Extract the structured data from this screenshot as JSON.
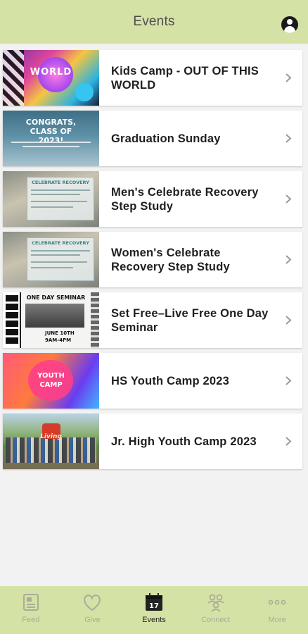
{
  "header": {
    "title": "Events"
  },
  "events": [
    {
      "title": "Kids Camp - OUT OF THIS WORLD",
      "thumb_text": "WORLD"
    },
    {
      "title": "Graduation Sunday",
      "thumb_text": "CONGRATS, CLASS OF 2023!"
    },
    {
      "title": "Men's Celebrate Recovery Step Study",
      "thumb_text": "CELEBRATE RECOVERY"
    },
    {
      "title": "Women's Celebrate Recovery Step Study",
      "thumb_text": "CELEBRATE RECOVERY"
    },
    {
      "title": "Set Free–Live Free One Day Seminar",
      "thumb_text": "ONE DAY SEMINAR",
      "thumb_text_2": "JUNE 10TH",
      "thumb_text_3": "9AM-4PM"
    },
    {
      "title": "HS Youth Camp 2023",
      "thumb_text": "YOUTH CAMP"
    },
    {
      "title": "Jr. High Youth Camp 2023",
      "thumb_text": "Living"
    }
  ],
  "tabbar": {
    "tabs": [
      {
        "label": "Feed",
        "icon": "feed-icon"
      },
      {
        "label": "Give",
        "icon": "heart-icon"
      },
      {
        "label": "Events",
        "icon": "calendar-icon",
        "badge": "17"
      },
      {
        "label": "Connect",
        "icon": "people-icon"
      },
      {
        "label": "More",
        "icon": "more-dots-icon"
      }
    ],
    "active": "Events"
  },
  "colors": {
    "header_bg": "#d5e2a6",
    "tabbar_bg": "#d5e2a6",
    "inactive_tab": "#a8ad99",
    "active_tab": "#222222"
  }
}
